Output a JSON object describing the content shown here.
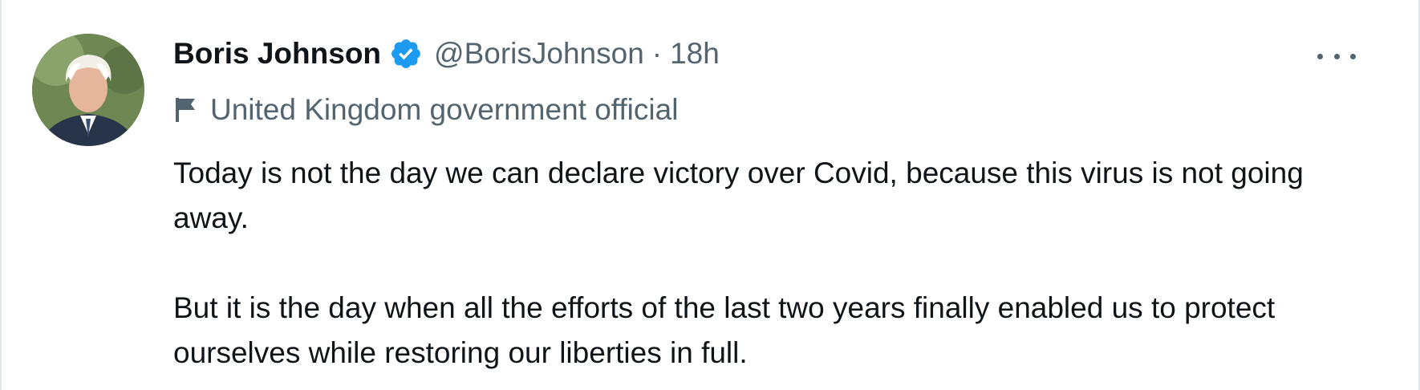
{
  "tweet": {
    "author": {
      "display_name": "Boris Johnson",
      "handle": "@BorisJohnson",
      "verified": true
    },
    "separator": "·",
    "time_ago": "18h",
    "label": "United Kingdom government official",
    "paragraphs": [
      "Today is not the day we can declare victory over Covid, because this virus is not going away.",
      "But it is the day when all the efforts of the last two years finally enabled us to protect ourselves while restoring our liberties in full."
    ]
  },
  "colors": {
    "verified_badge": "#1d9bf0",
    "secondary_text": "#536471",
    "primary_text": "#0f1419"
  },
  "icons": {
    "verified": "verified-badge-icon",
    "label": "flag-icon",
    "menu": "more-icon"
  }
}
